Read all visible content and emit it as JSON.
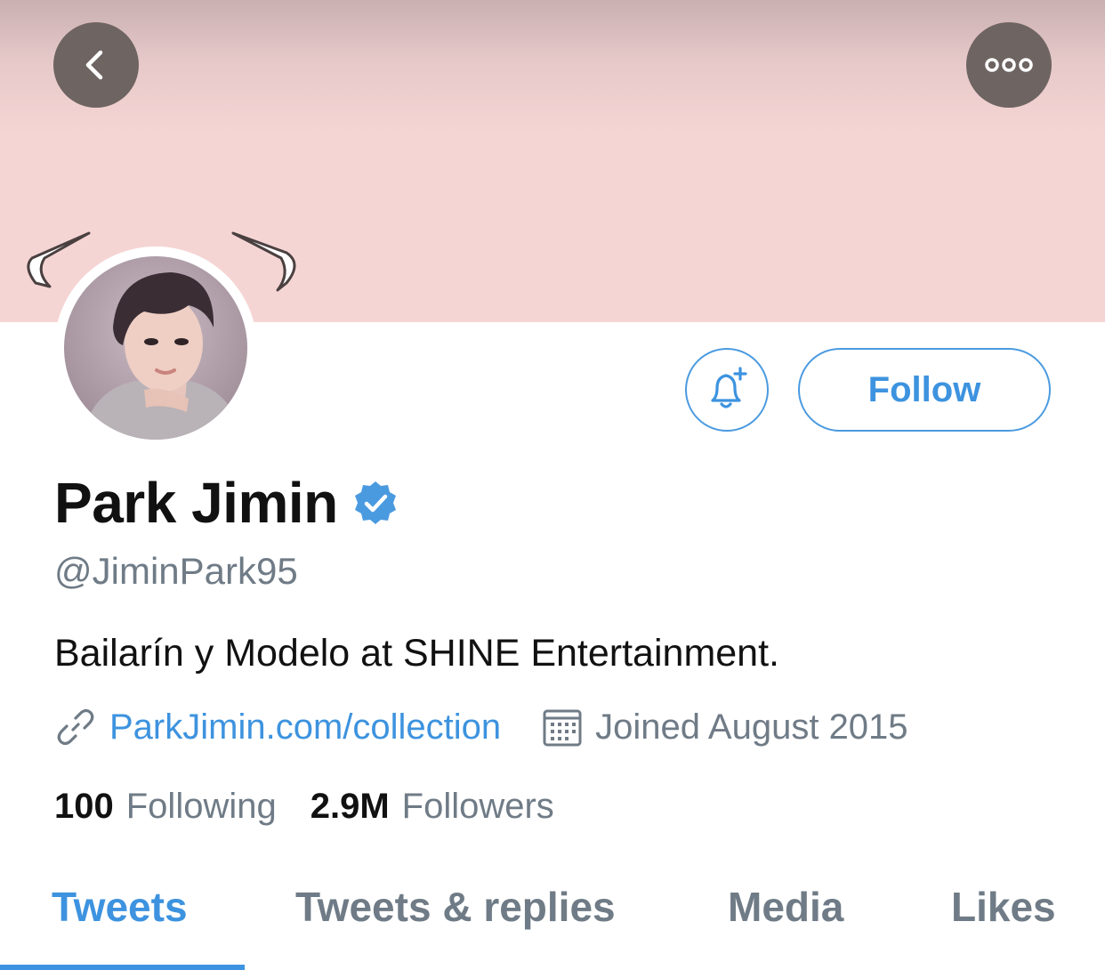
{
  "header": {
    "back_icon": "chevron-left-icon",
    "more_icon": "more-horizontal-icon"
  },
  "actions": {
    "notify_icon": "bell-plus-icon",
    "follow_label": "Follow"
  },
  "profile": {
    "name": "Park Jimin",
    "verified_icon": "verified-badge-icon",
    "handle": "@JiminPark95",
    "bio": "Bailarín y Modelo at SHINE Entertainment.",
    "link_icon": "link-icon",
    "website": "ParkJimin.com/collection",
    "calendar_icon": "calendar-icon",
    "joined": "Joined August 2015"
  },
  "stats": {
    "following_count": "100",
    "following_label": "Following",
    "followers_count": "2.9M",
    "followers_label": "Followers"
  },
  "tabs": [
    {
      "label": "Tweets",
      "active": true
    },
    {
      "label": "Tweets & replies",
      "active": false
    },
    {
      "label": "Media",
      "active": false
    },
    {
      "label": "Likes",
      "active": false
    }
  ],
  "colors": {
    "accent": "#3d93df",
    "banner": "#f5d5d4",
    "muted_text": "#6f7b86"
  }
}
